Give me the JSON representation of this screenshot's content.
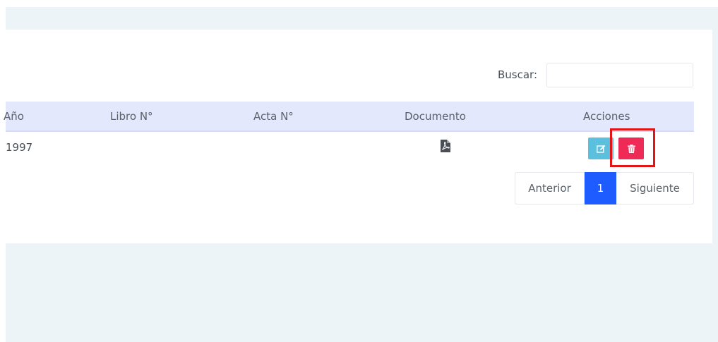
{
  "search": {
    "label": "Buscar:",
    "value": ""
  },
  "table": {
    "headers": [
      "Año",
      "Libro N°",
      "Acta N°",
      "Documento",
      "Acciones"
    ],
    "rows": [
      {
        "anio": "1997",
        "libro": "",
        "acta": ""
      }
    ]
  },
  "actions": {
    "edit_icon": "edit-icon",
    "delete_icon": "trash-icon"
  },
  "pagination": {
    "prev": "Anterior",
    "current": "1",
    "next": "Siguiente"
  },
  "colors": {
    "edit_button": "#5bc0de",
    "delete_button": "#ee2a56",
    "active_page": "#1f5cff",
    "highlight": "#e31414"
  }
}
